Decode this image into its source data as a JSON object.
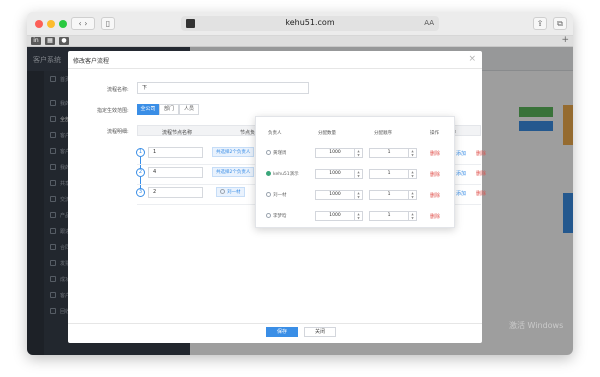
{
  "browser": {
    "url": "kehu51.com",
    "reader_label": "AA"
  },
  "app": {
    "brand": "客户系统",
    "nav": [
      "首页",
      "我的客户",
      "全部客户",
      "客户机会",
      "客户报表",
      "我的客户",
      "共享客户",
      "交流客户",
      "产品管理",
      "跟进记录",
      "合同申请",
      "发票管理",
      "成功订单",
      "客户管理",
      "回收站"
    ],
    "active_nav": "全部客户"
  },
  "modal": {
    "title": "修改客户流程",
    "name_label": "流程名称:",
    "name_value": "下",
    "scope_label": "指定生效范围:",
    "scope_options": [
      "全公司",
      "部门",
      "人员"
    ],
    "scope_selected": "全公司",
    "steps_label": "流程明细:",
    "columns": [
      "流程节点名称",
      "节点负责人",
      "操作"
    ],
    "steps": [
      {
        "no": "1",
        "name": "1",
        "owner": "共选择2个负责人"
      },
      {
        "no": "2",
        "name": "4",
        "owner": "共选择2个负责人"
      },
      {
        "no": "3",
        "name": "2",
        "owner": "刘一材"
      }
    ],
    "row_actions": {
      "add": "添加",
      "delete": "删除"
    },
    "save": "保存",
    "close": "关闭"
  },
  "popover": {
    "columns": [
      "负责人",
      "分配数量",
      "分配顺序",
      "操作"
    ],
    "rows": [
      {
        "name": "黄瑾周",
        "qty": "1000",
        "order": "1",
        "action": "删除"
      },
      {
        "name": "kehu51演示",
        "qty": "1000",
        "order": "1",
        "action": "删除"
      },
      {
        "name": "刘一材",
        "qty": "1000",
        "order": "1",
        "action": "删除"
      },
      {
        "name": "李梦晗",
        "qty": "1000",
        "order": "1",
        "action": "删除"
      }
    ]
  },
  "watermark": "激活 Windows"
}
